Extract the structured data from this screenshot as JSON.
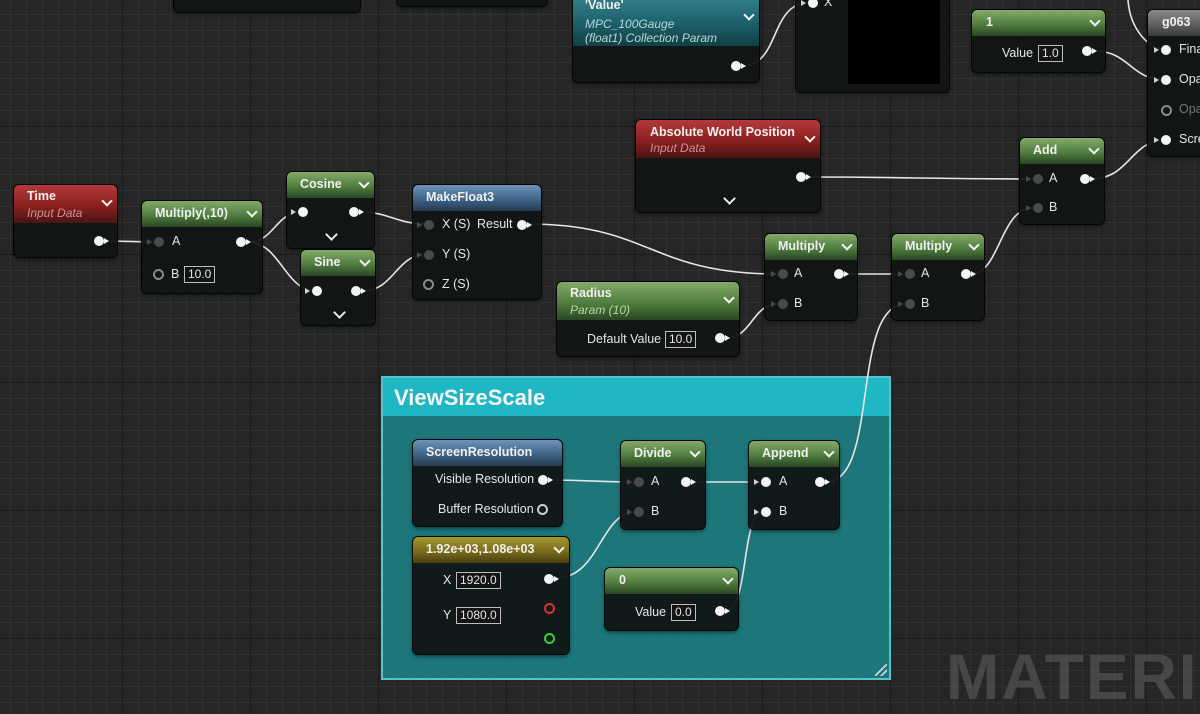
{
  "watermark": "MATERIAL",
  "nodes": {
    "time": {
      "title": "Time",
      "subtitle": "Input Data"
    },
    "multiply_10": {
      "title": "Multiply(,10)",
      "pin_a": "A",
      "pin_b": "B",
      "b_value": "10.0"
    },
    "cosine": {
      "title": "Cosine"
    },
    "sine": {
      "title": "Sine"
    },
    "makefloat3": {
      "title": "MakeFloat3",
      "x": "X (S)",
      "y": "Y (S)",
      "z": "Z (S)",
      "result": "Result"
    },
    "collection_param": {
      "title": "'Value'",
      "line1": "MPC_100Gauge",
      "line2": "(float1) Collection Param"
    },
    "preview": {
      "pin": "X"
    },
    "scalar_1": {
      "title": "1",
      "value_label": "Value",
      "value": "1.0"
    },
    "result_node": {
      "title": "g063",
      "pins": [
        "Fina",
        "Opa",
        "Opa",
        "Scre"
      ]
    },
    "abs_world_pos": {
      "title": "Absolute World Position",
      "subtitle": "Input Data"
    },
    "add": {
      "title": "Add",
      "pin_a": "A",
      "pin_b": "B"
    },
    "multiply_1": {
      "title": "Multiply",
      "pin_a": "A",
      "pin_b": "B"
    },
    "multiply_2": {
      "title": "Multiply",
      "pin_a": "A",
      "pin_b": "B"
    },
    "radius": {
      "title": "Radius",
      "subtitle": "Param (10)",
      "default_label": "Default Value",
      "default_value": "10.0"
    },
    "screen_resolution": {
      "title": "ScreenResolution",
      "visible": "Visible Resolution",
      "buffer": "Buffer Resolution"
    },
    "divide": {
      "title": "Divide",
      "pin_a": "A",
      "pin_b": "B"
    },
    "append": {
      "title": "Append",
      "pin_a": "A",
      "pin_b": "B"
    },
    "const2": {
      "title": "1.92e+03,1.08e+03",
      "x_label": "X",
      "x_value": "1920.0",
      "y_label": "Y",
      "y_value": "1080.0"
    },
    "scalar_0": {
      "title": "0",
      "value_label": "Value",
      "value": "0.0"
    }
  },
  "comment": {
    "title": "ViewSizeScale"
  },
  "colors": {
    "wire": "#e8e8e8",
    "comment_fill": "#1a9aa0",
    "comment_header": "#1fb7c4",
    "grid": "#262626"
  }
}
